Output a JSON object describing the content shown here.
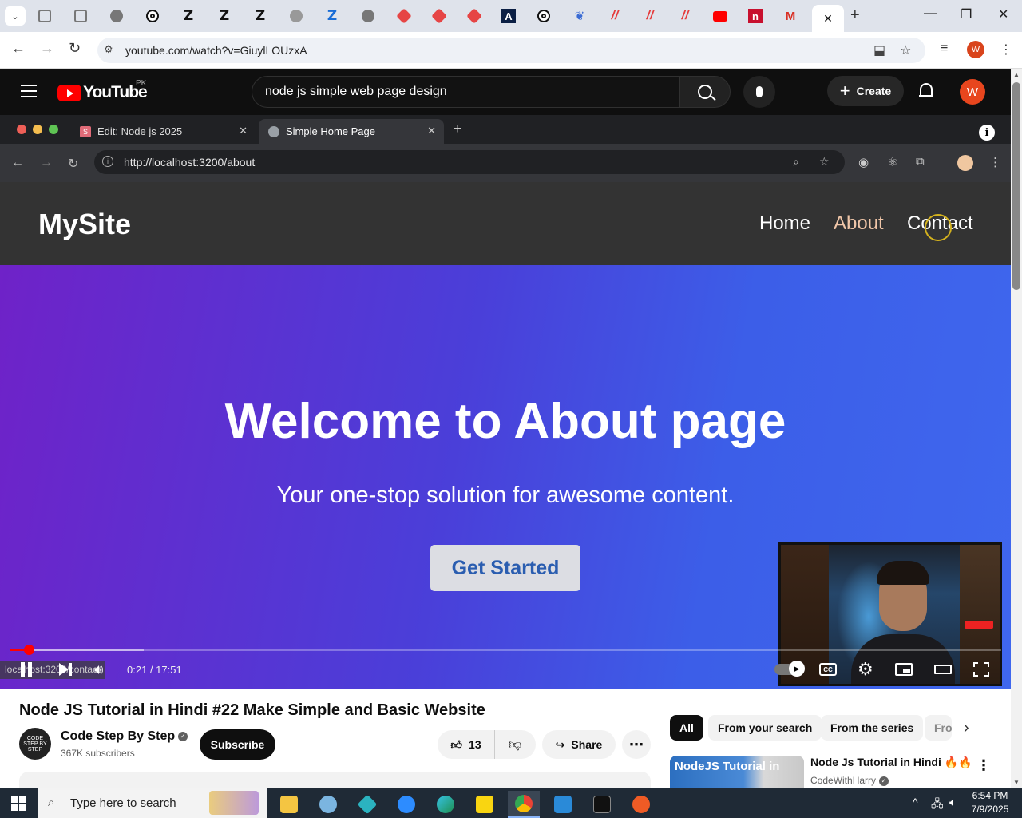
{
  "browser": {
    "url": "youtube.com/watch?v=GiuylLOUzxA",
    "active_tab_close": "✕",
    "profile_initial": "W"
  },
  "youtube": {
    "logo_text": "YouTube",
    "country": "PK",
    "search_query": "node js simple web page design",
    "create_label": "Create",
    "avatar_initial": "W"
  },
  "video_browser": {
    "tab1_label": "Edit: Node js 2025",
    "tab1_icon": "S",
    "tab2_label": "Simple Home Page",
    "url": "http://localhost:3200/about"
  },
  "site": {
    "logo": "MySite",
    "nav": [
      "Home",
      "About",
      "Contact"
    ],
    "active_nav": "About",
    "hero_title": "Welcome to About page",
    "hero_subtitle": "Your one-stop solution for awesome content.",
    "cta_label": "Get Started"
  },
  "player": {
    "time_display": "0:21 / 17:51",
    "hover_url": "localhost:3200/contact",
    "progress_played": 0.0196,
    "progress_buffered": 0.135,
    "accent_color": "#ff0000"
  },
  "video": {
    "title": "Node JS Tutorial in Hindi #22 Make Simple and Basic Website",
    "channel_name": "Code Step By Step",
    "channel_avatar_text": "CODE STEP BY STEP",
    "subscribers": "367K subscribers",
    "subscribe_label": "Subscribe",
    "likes": "13",
    "share_label": "Share"
  },
  "recommendations": {
    "chips": [
      "All",
      "From your search",
      "From the series",
      "Fro"
    ],
    "active_chip": "All",
    "first": {
      "thumb_text": "NodeJS Tutorial in",
      "title": "Node Js Tutorial in Hindi 🔥🔥",
      "channel": "CodeWithHarry"
    }
  },
  "taskbar": {
    "search_placeholder": "Type here to search",
    "time": "6:54 PM",
    "date": "7/9/2025"
  }
}
